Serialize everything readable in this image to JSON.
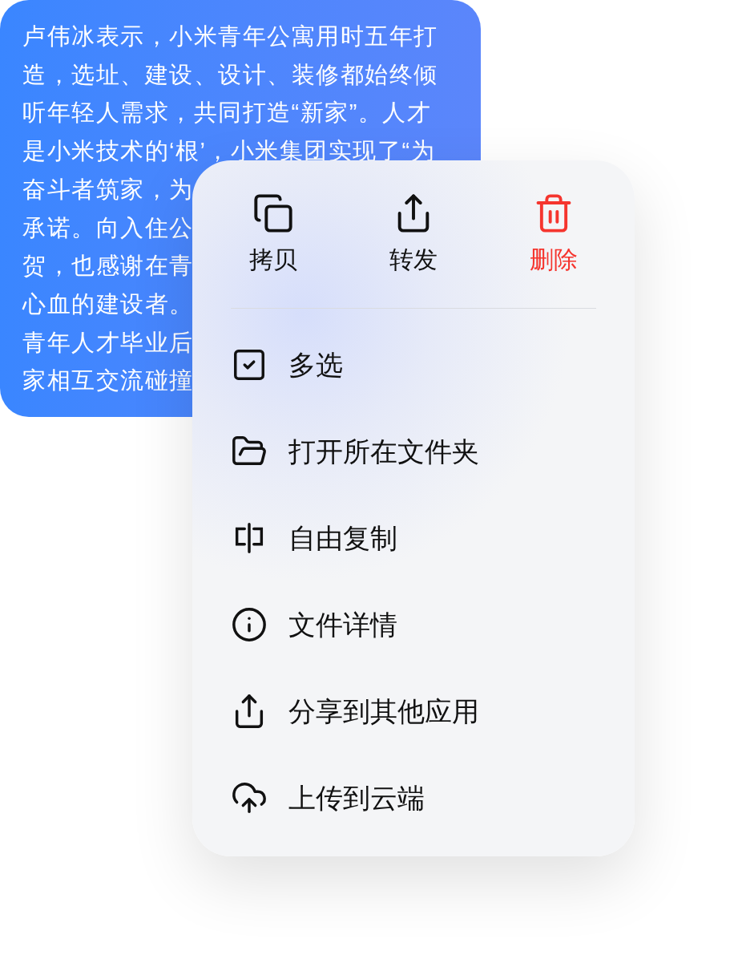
{
  "message": {
    "lines": [
      "卢伟冰表示，小米青年公寓用时五年打",
      "造，选址、建设、设计、装修都始终倾",
      "听年轻人需求，共同打造“新家”。人才",
      "是小米技术的‘根’，小米集团实现了“为",
      "奋斗者筑家，为",
      "承诺。向入住公",
      "贺，也感谢在青",
      "心血的建设者。",
      "青年人才毕业后",
      "家相互交流碰撞"
    ]
  },
  "menu": {
    "actions": [
      {
        "label": "拷贝",
        "kind": "copy"
      },
      {
        "label": "转发",
        "kind": "forward"
      },
      {
        "label": "删除",
        "kind": "delete"
      }
    ],
    "items": [
      {
        "label": "多选",
        "kind": "multiselect"
      },
      {
        "label": "打开所在文件夹",
        "kind": "folder"
      },
      {
        "label": "自由复制",
        "kind": "freecopy"
      },
      {
        "label": "文件详情",
        "kind": "info"
      },
      {
        "label": "分享到其他应用",
        "kind": "share"
      },
      {
        "label": "上传到云端",
        "kind": "cloud"
      }
    ]
  }
}
